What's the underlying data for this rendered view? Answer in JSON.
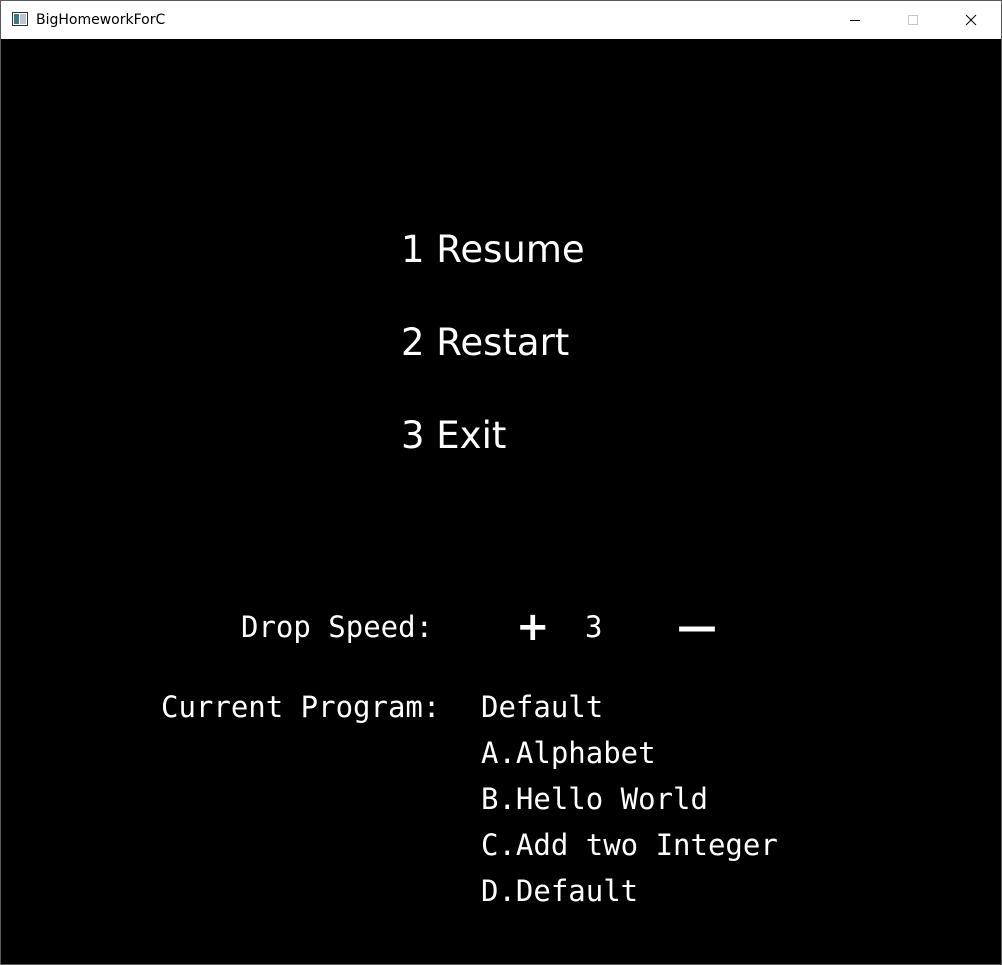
{
  "window": {
    "title": "BigHomeworkForC"
  },
  "menu": {
    "items": [
      {
        "label": "1 Resume"
      },
      {
        "label": "2 Restart"
      },
      {
        "label": "3 Exit"
      }
    ]
  },
  "settings": {
    "drop_speed_label": "Drop Speed:",
    "increase_label": "+",
    "speed_value": "3",
    "decrease_label": "—",
    "current_program_label": "Current Program:",
    "current_program_value": "Default",
    "program_options": [
      {
        "label": "A.Alphabet"
      },
      {
        "label": "B.Hello World"
      },
      {
        "label": "C.Add two Integer"
      },
      {
        "label": "D.Default"
      }
    ]
  },
  "icons": {
    "app": "app-window-icon",
    "minimize": "minimize-icon",
    "maximize": "maximize-icon",
    "close": "close-icon"
  },
  "colors": {
    "background": "#000000",
    "text": "#ffffff",
    "titlebar": "#ffffff"
  }
}
